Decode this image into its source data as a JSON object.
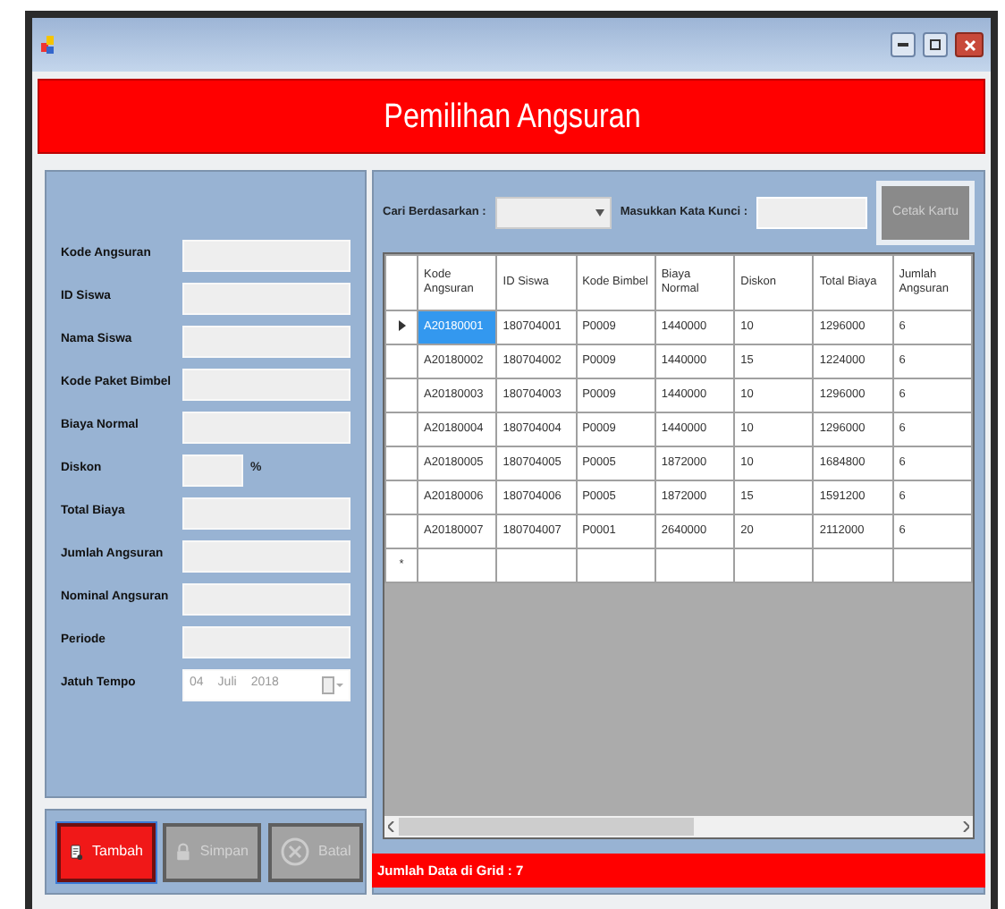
{
  "header": {
    "title": "Pemilihan Angsuran"
  },
  "form": {
    "fields": [
      {
        "label": "Kode Angsuran",
        "kind": "text"
      },
      {
        "label": "ID Siswa",
        "kind": "text"
      },
      {
        "label": "Nama Siswa",
        "kind": "text"
      },
      {
        "label": "Kode Paket Bimbel",
        "kind": "text"
      },
      {
        "label": "Biaya Normal",
        "kind": "text"
      },
      {
        "label": "Diskon",
        "kind": "percent",
        "suffix": "%"
      },
      {
        "label": "Total Biaya",
        "kind": "text"
      },
      {
        "label": "Jumlah Angsuran",
        "kind": "text"
      },
      {
        "label": "Nominal Angsuran",
        "kind": "text"
      },
      {
        "label": "Periode",
        "kind": "text"
      },
      {
        "label": "Jatuh Tempo",
        "kind": "date",
        "day": "04",
        "month": "Juli",
        "year": "2018"
      }
    ]
  },
  "buttons": [
    {
      "label": "Tambah",
      "kind": "add",
      "disabled": false
    },
    {
      "label": "Simpan",
      "kind": "save",
      "disabled": true
    },
    {
      "label": "Batal",
      "kind": "cancel",
      "disabled": true
    }
  ],
  "search": {
    "by_label": "Cari Berdasarkan :",
    "keyword_label": "Masukkan Kata Kunci :",
    "print_button": {
      "label": "Cetak Kartu",
      "disabled": true
    }
  },
  "table": {
    "columns": [
      "Kode Angsuran",
      "ID Siswa",
      "Kode Bimbel",
      "Biaya Normal",
      "Diskon",
      "Total Biaya",
      "Jumlah Angsuran"
    ],
    "rows": [
      {
        "selected": true,
        "cells": [
          "A20180001",
          "180704001",
          "P0009",
          "1440000",
          "10",
          "1296000",
          "6"
        ]
      },
      {
        "selected": false,
        "cells": [
          "A20180002",
          "180704002",
          "P0009",
          "1440000",
          "15",
          "1224000",
          "6"
        ]
      },
      {
        "selected": false,
        "cells": [
          "A20180003",
          "180704003",
          "P0009",
          "1440000",
          "10",
          "1296000",
          "6"
        ]
      },
      {
        "selected": false,
        "cells": [
          "A20180004",
          "180704004",
          "P0009",
          "1440000",
          "10",
          "1296000",
          "6"
        ]
      },
      {
        "selected": false,
        "cells": [
          "A20180005",
          "180704005",
          "P0005",
          "1872000",
          "10",
          "1684800",
          "6"
        ]
      },
      {
        "selected": false,
        "cells": [
          "A20180006",
          "180704006",
          "P0005",
          "1872000",
          "15",
          "1591200",
          "6"
        ]
      },
      {
        "selected": false,
        "cells": [
          "A20180007",
          "180704007",
          "P0001",
          "2640000",
          "20",
          "2112000",
          "6"
        ]
      }
    ],
    "new_row_marker": "*"
  },
  "status_bar": "Jumlah Data di Grid : 7"
}
